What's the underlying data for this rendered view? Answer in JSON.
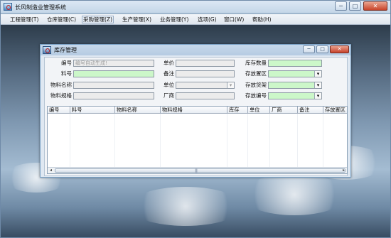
{
  "app": {
    "title": "长风制造业管理系统"
  },
  "window_controls": {
    "minimize": "─",
    "maximize": "□",
    "close": "✕"
  },
  "menu": [
    {
      "label": "工程管理(T)"
    },
    {
      "label": "仓库管理(C)"
    },
    {
      "label": "采购管理(Z)"
    },
    {
      "label": "生产管理(X)"
    },
    {
      "label": "业务管理(Y)"
    },
    {
      "label": "选项(G)"
    },
    {
      "label": "窗口(W)"
    },
    {
      "label": "帮助(H)"
    }
  ],
  "child_window": {
    "title": "库存管理",
    "controls": {
      "minimize": "─",
      "maximize": "□",
      "close": "✕"
    }
  },
  "form": {
    "col1": {
      "id_label": "编号",
      "id_placeholder": "编号自动生成!",
      "item_no_label": "料号",
      "material_name_label": "物料名称",
      "material_spec_label": "物料规格"
    },
    "col2": {
      "price_label": "单价",
      "remark_label": "备注",
      "unit_label": "单位",
      "vendor_label": "厂商"
    },
    "col3": {
      "stock_qty_label": "库存数量",
      "storage_zone_label": "存放置区",
      "storage_rack_label": "存放货架",
      "storage_code_label": "存放编号"
    },
    "dropdown_arrow": "▾"
  },
  "table": {
    "headers": [
      "编号",
      "料号",
      "物料名称",
      "物料规格",
      "库存",
      "单位",
      "厂商",
      "备注",
      "存放置区"
    ],
    "rows": []
  },
  "scrollbar": {
    "left": "◂",
    "right": "▸",
    "grip": "|||"
  },
  "colors": {
    "required_field": "#ccf7c9",
    "readonly_field": "#ececec",
    "title_bar": "#c4d6e8"
  }
}
